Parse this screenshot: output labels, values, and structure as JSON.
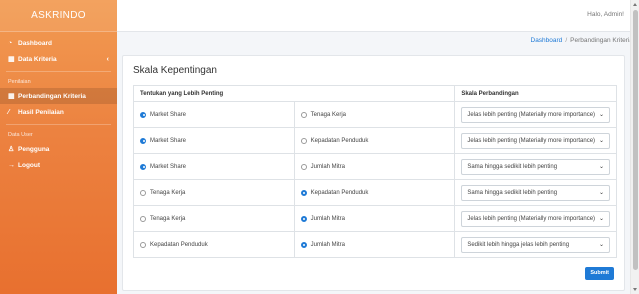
{
  "brand": "ASKRINDO",
  "topbar": {
    "greeting": "Halo, Admin!"
  },
  "sidebar": {
    "items": [
      {
        "label": "Dashboard",
        "icon": "dashboard-icon",
        "glyph": "◔"
      },
      {
        "label": "Data Kriteria",
        "icon": "table-icon",
        "glyph": "▦",
        "chevron": "‹"
      }
    ],
    "heading_penilaian": "Penilaian",
    "penilaian_items": [
      {
        "label": "Perbandingan Kriteria",
        "icon": "table-icon",
        "glyph": "▦",
        "active": true
      },
      {
        "label": "Hasil Penilaian",
        "icon": "chart-icon",
        "glyph": "⁄"
      }
    ],
    "heading_user": "Data User",
    "user_items": [
      {
        "label": "Pengguna",
        "icon": "user-icon",
        "glyph": "♙"
      },
      {
        "label": "Logout",
        "icon": "arrow-right-icon",
        "glyph": "→"
      }
    ]
  },
  "breadcrumb": {
    "home": "Dashboard",
    "separator": "/",
    "current": "Perbandingan Kriteria"
  },
  "card": {
    "title": "Skala Kepentingan",
    "headers": [
      "Tentukan yang Lebih Penting",
      "",
      "Skala Perbandingan"
    ],
    "rows": [
      {
        "a": "Market Share",
        "b": "Tenaga Kerja",
        "selected": "a",
        "scale": "Jelas lebih penting (Materially more importance)"
      },
      {
        "a": "Market Share",
        "b": "Kepadatan Penduduk",
        "selected": "a",
        "scale": "Jelas lebih penting (Materially more importance)"
      },
      {
        "a": "Market Share",
        "b": "Jumlah Mitra",
        "selected": "a",
        "scale": "Sama hingga sedikit lebih penting"
      },
      {
        "a": "Tenaga Kerja",
        "b": "Kepadatan Penduduk",
        "selected": "b",
        "scale": "Sama hingga sedikit lebih penting"
      },
      {
        "a": "Tenaga Kerja",
        "b": "Jumlah Mitra",
        "selected": "b",
        "scale": "Jelas lebih penting (Materially more importance)"
      },
      {
        "a": "Kepadatan Penduduk",
        "b": "Jumlah Mitra",
        "selected": "b",
        "scale": "Sedikit lebih hingga jelas lebih penting"
      }
    ],
    "submit_label": "Submit"
  },
  "colors": {
    "sidebar_top": "#f29b52",
    "sidebar_bottom": "#e8702f",
    "accent": "#1f7ad6"
  }
}
